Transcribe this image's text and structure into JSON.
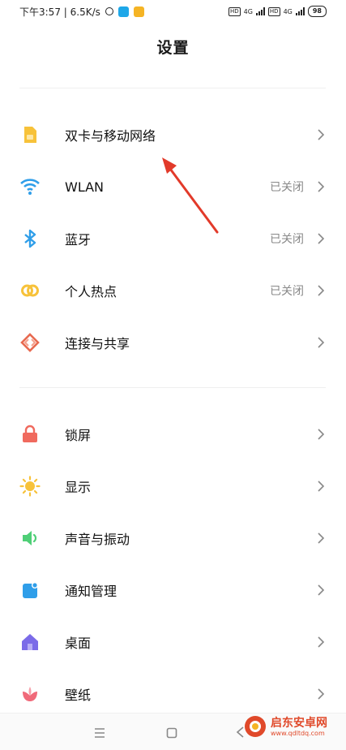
{
  "status_bar": {
    "time_speed": "下午3:57 | 6.5K/s",
    "hd1": "HD",
    "sig1": "4G",
    "hd2": "HD",
    "sig2": "4G",
    "battery": "98"
  },
  "title": "设置",
  "settings": [
    {
      "id": "dual-sim",
      "label": "双卡与移动网络",
      "value": "",
      "icon": "sim-card-icon",
      "color": "#f7c23a"
    },
    {
      "id": "wlan",
      "label": "WLAN",
      "value": "已关闭",
      "icon": "wifi-icon",
      "color": "#2f9ee9"
    },
    {
      "id": "bluetooth",
      "label": "蓝牙",
      "value": "已关闭",
      "icon": "bluetooth-icon",
      "color": "#2f9ee9"
    },
    {
      "id": "hotspot",
      "label": "个人热点",
      "value": "已关闭",
      "icon": "hotspot-icon",
      "color": "#f7c23a"
    },
    {
      "id": "connection-sharing",
      "label": "连接与共享",
      "value": "",
      "icon": "connection-share-icon",
      "color": "#e86a50"
    },
    {
      "id": "lock-screen",
      "label": "锁屏",
      "value": "",
      "icon": "lock-icon",
      "color": "#f06a5e"
    },
    {
      "id": "display",
      "label": "显示",
      "value": "",
      "icon": "sun-icon",
      "color": "#f7c23a"
    },
    {
      "id": "sound",
      "label": "声音与振动",
      "value": "",
      "icon": "speaker-icon",
      "color": "#4fcf77"
    },
    {
      "id": "notifications",
      "label": "通知管理",
      "value": "",
      "icon": "notification-icon",
      "color": "#2f9ee9"
    },
    {
      "id": "home-screen",
      "label": "桌面",
      "value": "",
      "icon": "home-icon",
      "color": "#7b6be8"
    },
    {
      "id": "wallpaper",
      "label": "壁纸",
      "value": "",
      "icon": "flower-icon",
      "color": "#f06a7a"
    }
  ],
  "watermark": {
    "text": "启东安卓网",
    "url": "www.qdltdq.com"
  }
}
